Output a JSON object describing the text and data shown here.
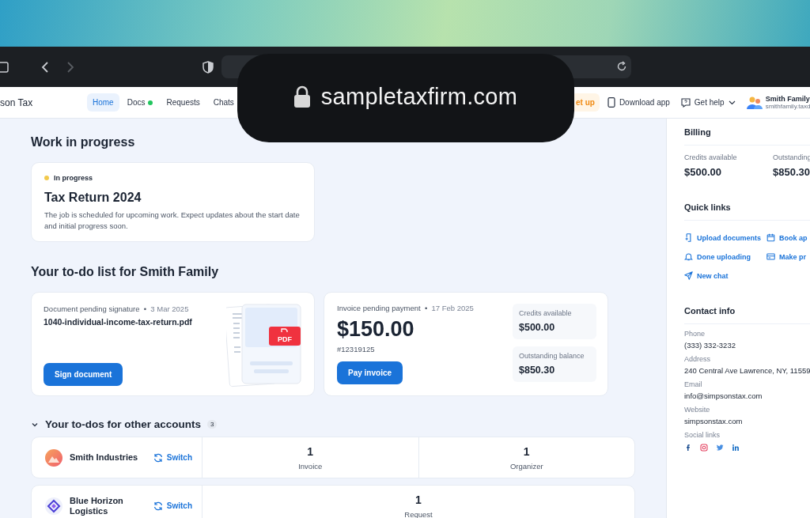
{
  "browser": {
    "url": "sampletaxfirm.com"
  },
  "nav": {
    "brand": "son Tax",
    "tabs": [
      {
        "label": "Home",
        "selected": true,
        "dot": false
      },
      {
        "label": "Docs",
        "selected": false,
        "dot": true
      },
      {
        "label": "Requests",
        "selected": false,
        "dot": false
      },
      {
        "label": "Chats",
        "selected": false,
        "dot": false
      }
    ],
    "setup": "et up",
    "download": "Download app",
    "help": "Get help",
    "user": {
      "name": "Smith Family",
      "email": "smithfamily.taxd"
    }
  },
  "work": {
    "heading": "Work in progress",
    "status": "In progress",
    "color": "#f2c94c",
    "title": "Tax Return 2024",
    "description": "The job is scheduled for upcoming work. Expect updates about the start date and initial progress soon."
  },
  "todo": {
    "heading": "Your to-do list for Smith Family",
    "document": {
      "label": "Document pending signature",
      "separator": "•",
      "date": "3 Mar 2025",
      "badge": "PDF",
      "file": "1040-individual-income-tax-return.pdf",
      "button": "Sign document"
    },
    "invoice": {
      "label": "Invoice pending payment",
      "separator": "•",
      "date": "17 Feb 2025",
      "amount": "$150.00",
      "number": "#12319125",
      "button": "Pay invoice",
      "stats": [
        {
          "label": "Credits available",
          "value": "$500.00"
        },
        {
          "label": "Outstanding balance",
          "value": "$850.30"
        }
      ]
    }
  },
  "other": {
    "heading": "Your to-dos for other accounts",
    "count": "3",
    "expanded": true,
    "accounts": [
      {
        "name": "Smith Industries",
        "kind": "peak",
        "switch": "Switch",
        "items": [
          {
            "count": "1",
            "label": "Invoice"
          },
          {
            "count": "1",
            "label": "Organizer"
          }
        ]
      },
      {
        "name": "Blue Horizon Logistics",
        "kind": "diamond",
        "switch": "Switch",
        "items": [
          {
            "count": "1",
            "label": "Request"
          }
        ]
      }
    ]
  },
  "sidebar": {
    "billing": {
      "heading": "Billing",
      "stats": [
        {
          "label": "Credits available",
          "value": "$500.00"
        },
        {
          "label": "Outstanding",
          "value": "$850.30"
        }
      ]
    },
    "quick_links": {
      "heading": "Quick links",
      "links": [
        {
          "label": "Upload documents",
          "kind": "upload"
        },
        {
          "label": "Book ap",
          "kind": "calendar"
        },
        {
          "label": "Done uploading",
          "kind": "bell"
        },
        {
          "label": "Make pr",
          "kind": "card"
        },
        {
          "label": "New chat",
          "kind": "send"
        }
      ]
    },
    "contact": {
      "heading": "Contact info",
      "fields": [
        {
          "label": "Phone",
          "value": "(333) 332-3232"
        },
        {
          "label": "Address",
          "value": "240 Central Ave Lawrence, NY, 11559"
        },
        {
          "label": "Email",
          "value": "info@simpsonstax.com"
        },
        {
          "label": "Website",
          "value": "simpsonstax.com"
        }
      ],
      "social_label": "Social links",
      "social": [
        {
          "kind": "facebook"
        },
        {
          "kind": "instagram"
        },
        {
          "kind": "twitter"
        },
        {
          "kind": "linkedin"
        }
      ]
    }
  }
}
